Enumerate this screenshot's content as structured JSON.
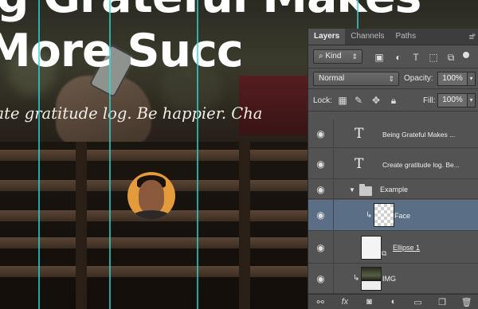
{
  "canvas": {
    "headline_line1": "ng Grateful Makes",
    "headline_line2": "More Succ",
    "subline": "eate gratitude log. Be happier. Cha"
  },
  "panel": {
    "tabs": [
      {
        "label": "Layers",
        "active": true
      },
      {
        "label": "Channels",
        "active": false
      },
      {
        "label": "Paths",
        "active": false
      }
    ],
    "menu_icon": "panel-menu-icon",
    "filter_kind": "Kind",
    "blend_mode": "Normal",
    "opacity_label": "Opacity:",
    "opacity_value": "100%",
    "lock_label": "Lock:",
    "fill_label": "Fill:",
    "fill_value": "100%",
    "layers": [
      {
        "name": "Being Grateful Makes ...",
        "type": "text"
      },
      {
        "name": "Create gratitude log. Be...",
        "type": "text"
      },
      {
        "name": "Example",
        "type": "group"
      },
      {
        "name": "Face",
        "type": "pixel",
        "selected": true
      },
      {
        "name": "Ellipse 1",
        "type": "shape"
      },
      {
        "name": "IMG",
        "type": "image"
      }
    ],
    "bottom_icons": [
      "link-icon",
      "fx-icon",
      "mask-icon",
      "adjustment-icon",
      "folder-icon",
      "new-layer-icon",
      "trash-icon"
    ]
  },
  "colors": {
    "guide": "#2fd7d3",
    "selected_layer": "#5a6e85",
    "panel_bg": "#535353",
    "avatar_bg": "#e39b3b"
  }
}
